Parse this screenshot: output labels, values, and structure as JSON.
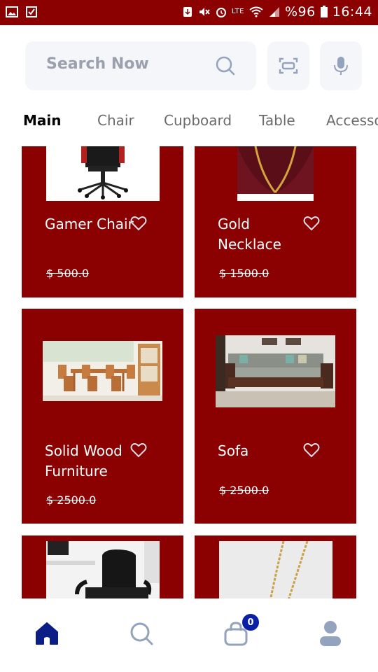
{
  "status_bar": {
    "battery": "%96",
    "time": "16:44",
    "lte": "LTE"
  },
  "search": {
    "placeholder": "Search Now"
  },
  "tabs": [
    "Main",
    "Chair",
    "Cupboard",
    "Table",
    "Accessories"
  ],
  "products": [
    {
      "name": "Gamer Chair",
      "price": "$ 500.0"
    },
    {
      "name": "Gold Necklace",
      "price": "$ 1500.0"
    },
    {
      "name": "Solid Wood Furniture",
      "price": "$ 2500.0"
    },
    {
      "name": "Sofa",
      "price": "$ 2500.0"
    }
  ],
  "cart": {
    "count": "0"
  },
  "colors": {
    "brand": "#8b0000",
    "accent": "#0a1ea8",
    "icon_muted": "#93a3bd"
  }
}
